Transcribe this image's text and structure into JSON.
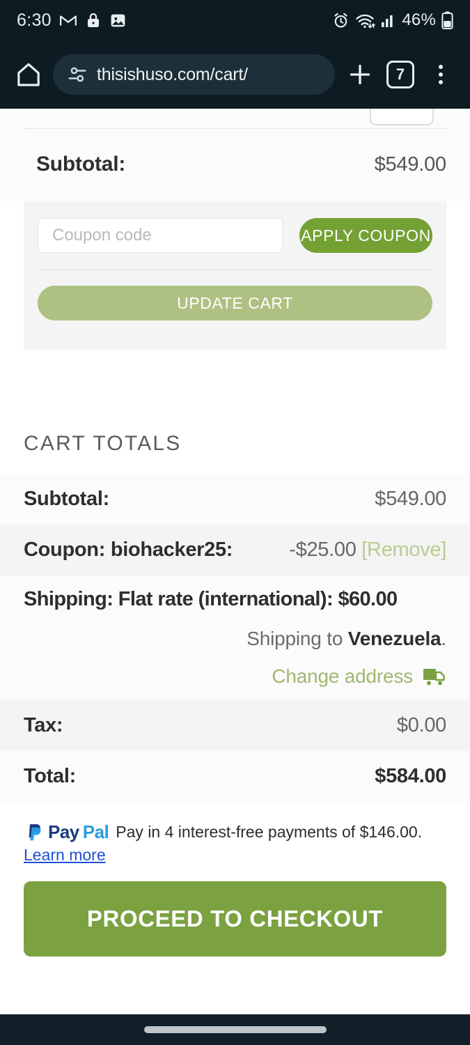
{
  "status_bar": {
    "time": "6:30",
    "battery_percent": "46%",
    "left_icons": [
      "gmail-icon",
      "lock-icon",
      "image-icon"
    ],
    "right_icons": [
      "alarm-icon",
      "wifi-icon",
      "signal-icon",
      "battery-icon"
    ]
  },
  "browser": {
    "home_icon": "home-icon",
    "site_info_icon": "tune-icon",
    "url": "thisishuso.com/cart/",
    "new_tab_icon": "plus-icon",
    "tab_count": "7",
    "menu_icon": "overflow-menu-icon"
  },
  "cart": {
    "subtotal_label": "Subtotal:",
    "subtotal_value": "$549.00",
    "coupon_placeholder": "Coupon code",
    "coupon_value": "",
    "apply_coupon_label": "APPLY COUPON",
    "update_cart_label": "UPDATE CART"
  },
  "totals": {
    "title": "CART TOTALS",
    "rows": [
      {
        "label": "Subtotal:",
        "value": "$549.00"
      },
      {
        "label": "Coupon: biohacker25:",
        "value": "-$25.00",
        "remove_label": "[Remove]"
      },
      {
        "label": "Tax:",
        "value": "$0.00"
      },
      {
        "label": "Total:",
        "value": "$584.00"
      }
    ],
    "shipping_heading": "Shipping: Flat rate (international): $60.00",
    "shipping_to_prefix": "Shipping to ",
    "shipping_country": "Venezuela",
    "shipping_to_suffix": ".",
    "change_address_label": "Change address",
    "truck_icon": "delivery-truck-icon"
  },
  "paypal": {
    "brand_pay": "Pay",
    "brand_pal": "Pal",
    "promo_text": "Pay in 4 interest-free payments of $146.00.",
    "learn_more_label": "Learn more"
  },
  "checkout": {
    "label": "PROCEED TO CHECKOUT"
  },
  "colors": {
    "accent_green": "#74a134",
    "muted_green": "#aec183",
    "checkout_green": "#7ba141",
    "link_green": "#9fb872",
    "paypal_dark": "#1a3a7c",
    "paypal_light": "#2a9ce0"
  }
}
